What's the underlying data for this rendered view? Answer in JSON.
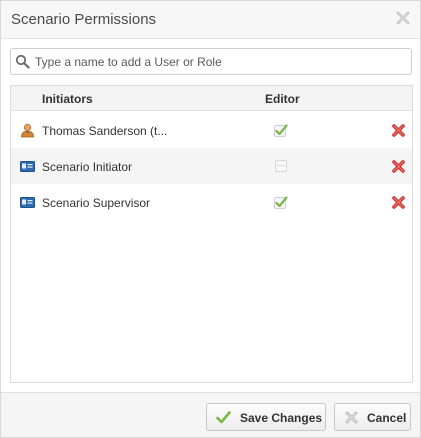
{
  "dialog": {
    "title": "Scenario Permissions"
  },
  "search": {
    "placeholder": "Type a name to add a User or Role",
    "value": ""
  },
  "grid": {
    "columns": {
      "initiators": "Initiators",
      "editor": "Editor"
    },
    "rows": [
      {
        "name": "Thomas Sanderson (t...",
        "type_icon": "user-icon",
        "editor": true
      },
      {
        "name": "Scenario Initiator",
        "type_icon": "role-card-icon",
        "editor": false
      },
      {
        "name": "Scenario Supervisor",
        "type_icon": "role-card-icon",
        "editor": true
      }
    ]
  },
  "footer": {
    "save_label": "Save Changes",
    "cancel_label": "Cancel"
  },
  "colors": {
    "check_green": "#7ab648",
    "delete_red": "#d9534f",
    "role_blue": "#2e6bb5",
    "user_orange": "#e08a2c"
  }
}
